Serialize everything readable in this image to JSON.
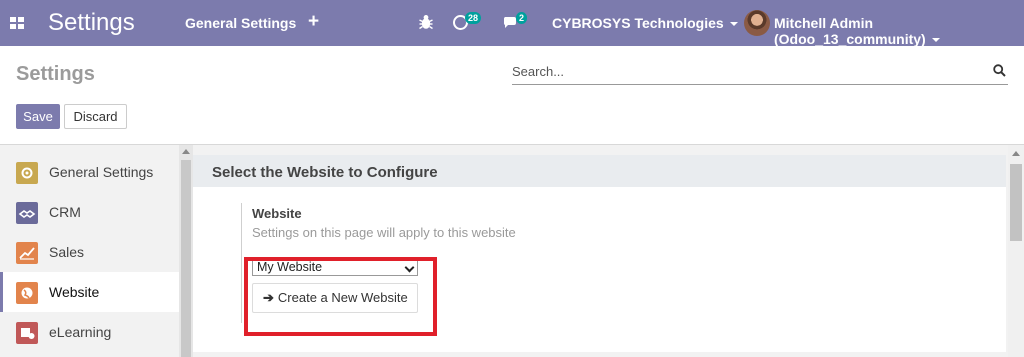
{
  "navbar": {
    "app_title": "Settings",
    "menu_item": "General Settings",
    "quick_create_symbol": "+",
    "activity_count": "28",
    "messages_count": "2",
    "company": "CYBROSYS Technologies",
    "user": "Mitchell Admin (Odoo_13_community)",
    "accent_color": "#7c7bad"
  },
  "control_panel": {
    "page_title": "Settings",
    "search_placeholder": "Search...",
    "save_label": "Save",
    "discard_label": "Discard"
  },
  "sidebar": {
    "items": [
      {
        "label": "General Settings",
        "icon": "gear-icon",
        "icon_color": "#c8a850"
      },
      {
        "label": "CRM",
        "icon": "handshake-icon",
        "icon_color": "#6b6b9a"
      },
      {
        "label": "Sales",
        "icon": "chart-line-icon",
        "icon_color": "#e2844c"
      },
      {
        "label": "Website",
        "icon": "globe-icon",
        "icon_color": "#e2844c",
        "active": true
      },
      {
        "label": "eLearning",
        "icon": "elearning-icon",
        "icon_color": "#c05858"
      }
    ]
  },
  "main": {
    "section_title": "Select the Website to Configure",
    "setting": {
      "name": "Website",
      "help": "Settings on this page will apply to this website",
      "selected_website": "My Website",
      "create_button": "Create a New Website"
    },
    "highlight_color": "#e0202a"
  }
}
